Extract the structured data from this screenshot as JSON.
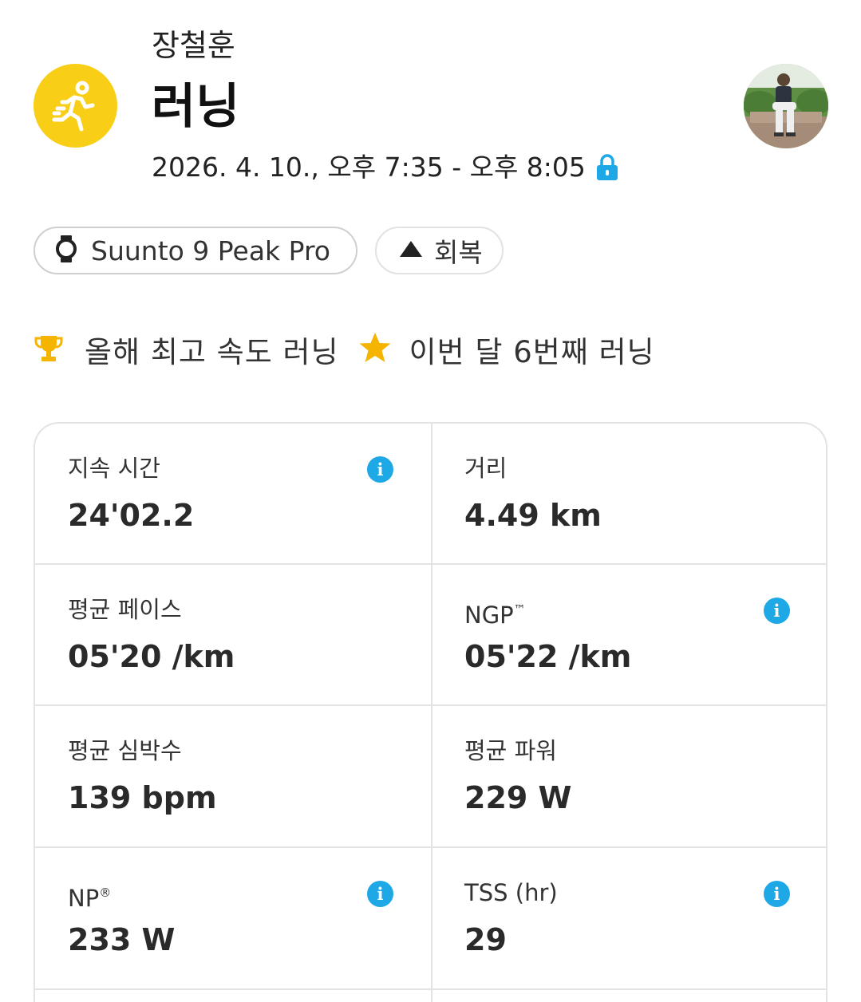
{
  "header": {
    "user_name": "장철훈",
    "activity_title": "러닝",
    "datetime": "2026. 4. 10., 오후 7:35 - 오후 8:05",
    "activity_icon": "running-person-icon",
    "accent_color": "#F8CE17"
  },
  "chips": {
    "device": "Suunto 9 Peak Pro",
    "feeling": "회복"
  },
  "achievements": [
    {
      "icon": "trophy-icon",
      "text": "올해 최고 속도 러닝"
    },
    {
      "icon": "star-icon",
      "text": "이번 달 6번째 러닝"
    }
  ],
  "stats": {
    "duration": {
      "label": "지속 시간",
      "value": "24'02.2"
    },
    "distance": {
      "label": "거리",
      "value": "4.49 km"
    },
    "avg_pace": {
      "label": "평균 페이스",
      "value": "05'20 /km"
    },
    "ngp": {
      "label": "NGP",
      "mark": "™",
      "value": "05'22 /km"
    },
    "avg_hr": {
      "label": "평균 심박수",
      "value": "139 bpm"
    },
    "avg_power": {
      "label": "평균 파워",
      "value": "229 W"
    },
    "np": {
      "label": "NP",
      "mark": "®",
      "value": "233 W"
    },
    "tss": {
      "label": "TSS (hr)",
      "value": "29"
    }
  },
  "colors": {
    "info": "#1EA8E6",
    "trophy": "#F5B400",
    "lock": "#1EA8E6"
  }
}
